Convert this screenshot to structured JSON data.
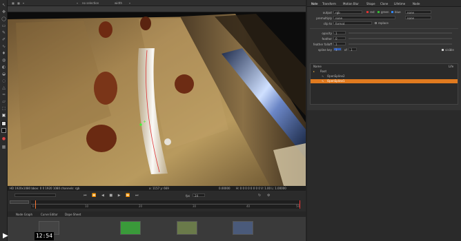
{
  "viewer": {
    "top_items": [
      "no selection",
      "width"
    ],
    "info_left": "HD 1920x1080 bbox: 0 0 1920 1080 channels: rgb",
    "info_mid": "x: 1157 y: 669",
    "info_vals": "0.00000",
    "info_right": "H: 0 0 0 0 0 0 0 0 V: 1.00 L: 1.00000",
    "fps_label": "fps",
    "fps_value": "24",
    "ticks": [
      "0",
      "10",
      "20",
      "30",
      "40",
      "50"
    ],
    "colors": {
      "red": "#e33",
      "green": "#3c3",
      "blue": "#38f"
    }
  },
  "props": {
    "tabs": [
      "Note",
      "Transform",
      "Motion Blur",
      "Shape",
      "Clone",
      "Lifetime",
      "Node"
    ],
    "output_label": "output",
    "output_value": "rgb",
    "channel_checks": [
      "red",
      "green",
      "blue"
    ],
    "none_value": "none",
    "premultiply_label": "premultiply",
    "premultiply_value": "none",
    "clip_label": "clip to",
    "clip_value": "format",
    "replace_label": "replace",
    "opacity_label": "opacity",
    "opacity_value": "1",
    "feather_label": "feather",
    "feather_value": "0",
    "falloff_label": "feather falloff",
    "falloff_value": "1",
    "spline_label": "spline key",
    "spline_value": "1",
    "spline_of": "of",
    "spline_count": "1",
    "visible_label": "visible",
    "layers": {
      "header": "Name",
      "root": "Root",
      "items": [
        "OpenSpline2",
        "OpenSpline1"
      ],
      "life": "Life"
    }
  },
  "bottom_tabs": [
    "Node Graph",
    "Curve Editor",
    "Dope Sheet"
  ],
  "video": {
    "time": "12:54"
  }
}
